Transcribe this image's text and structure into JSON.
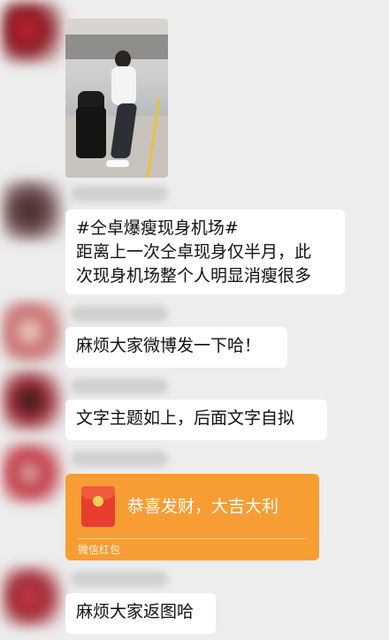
{
  "messages": [
    {
      "type": "image",
      "description": "photo"
    },
    {
      "type": "text",
      "lines": [
        "#仝卓爆瘦现身机场#",
        "距离上一次仝卓现身仅半月，此",
        "次现身机场整个人明显消瘦很多"
      ]
    },
    {
      "type": "text",
      "lines": [
        "麻烦大家微博发一下哈！"
      ]
    },
    {
      "type": "text",
      "lines": [
        "文字主题如上，后面文字自拟"
      ]
    },
    {
      "type": "red_packet",
      "title": "恭喜发财，大吉大利",
      "label": "微信红包"
    },
    {
      "type": "text",
      "lines": [
        "麻烦大家返图哈"
      ]
    }
  ],
  "colors": {
    "background": "#ededed",
    "bubble": "#ffffff",
    "red_packet": "#f79d34"
  }
}
